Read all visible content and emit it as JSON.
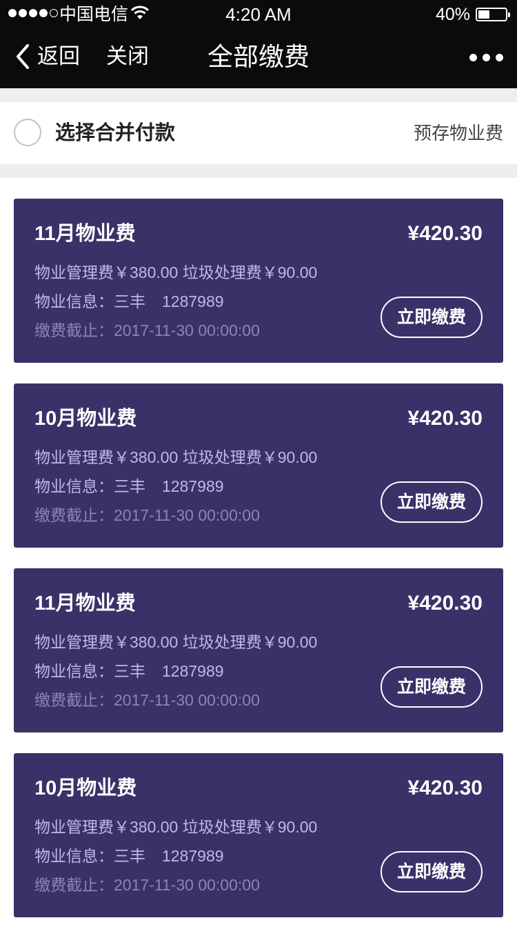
{
  "status_bar": {
    "carrier": "中国电信",
    "time": "4:20 AM",
    "battery": "40%"
  },
  "nav": {
    "back_label": "返回",
    "close_label": "关闭",
    "title": "全部缴费"
  },
  "select_bar": {
    "label": "选择合并付款",
    "prestore_link": "预存物业费"
  },
  "bills": [
    {
      "title": "11月物业费",
      "amount": "¥420.30",
      "fees": "物业管理费￥380.00 垃圾处理费￥90.00",
      "info_label": "物业信息：三丰",
      "info_code": "1287989",
      "deadline": "缴费截止：2017-11-30  00:00:00",
      "pay_button": "立即缴费"
    },
    {
      "title": "10月物业费",
      "amount": "¥420.30",
      "fees": "物业管理费￥380.00 垃圾处理费￥90.00",
      "info_label": "物业信息：三丰",
      "info_code": "1287989",
      "deadline": "缴费截止：2017-11-30  00:00:00",
      "pay_button": "立即缴费"
    },
    {
      "title": "11月物业费",
      "amount": "¥420.30",
      "fees": "物业管理费￥380.00 垃圾处理费￥90.00",
      "info_label": "物业信息：三丰",
      "info_code": "1287989",
      "deadline": "缴费截止：2017-11-30  00:00:00",
      "pay_button": "立即缴费"
    },
    {
      "title": "10月物业费",
      "amount": "¥420.30",
      "fees": "物业管理费￥380.00 垃圾处理费￥90.00",
      "info_label": "物业信息：三丰",
      "info_code": "1287989",
      "deadline": "缴费截止：2017-11-30  00:00:00",
      "pay_button": "立即缴费"
    }
  ],
  "colors": {
    "nav_bg": "#0b0b0b",
    "card_bg": "#3b3168",
    "card_text_secondary": "#c0b8e6",
    "card_text_muted": "#8c83b9",
    "separator": "#eeeeee"
  },
  "icons": {
    "signal": "signal-dots-icon",
    "wifi": "wifi-icon",
    "battery": "battery-icon",
    "back": "chevron-left-icon",
    "more": "more-dots-icon",
    "select": "radio-circle-icon"
  }
}
